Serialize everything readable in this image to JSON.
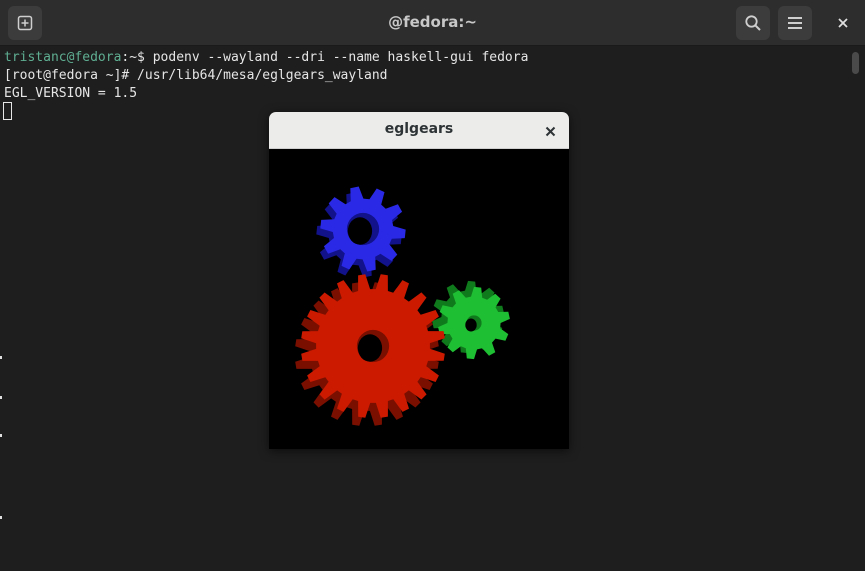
{
  "header": {
    "title": "@fedora:~",
    "new_tab_icon": "new-tab-icon",
    "search_icon": "search-icon",
    "menu_icon": "hamburger-menu-icon",
    "close_icon": "close-icon"
  },
  "terminal": {
    "line1": {
      "user_host": "tristanc@fedora",
      "prompt_rest": ":~$ ",
      "command": "podenv --wayland --dri --name haskell-gui fedora"
    },
    "line2": "[root@fedora ~]# /usr/lib64/mesa/eglgears_wayland",
    "line3": "EGL_VERSION = 1.5"
  },
  "eglgears_window": {
    "title": "eglgears",
    "close_icon": "close-icon"
  },
  "colors": {
    "terminal_bg": "#1e1e1e",
    "header_bg": "#2d2d2d",
    "prompt_user": "#5fae92",
    "text": "#e6e6e6",
    "gear_red": "#cc1a00",
    "gear_green": "#1fbf33",
    "gear_blue": "#2a2ae6"
  }
}
